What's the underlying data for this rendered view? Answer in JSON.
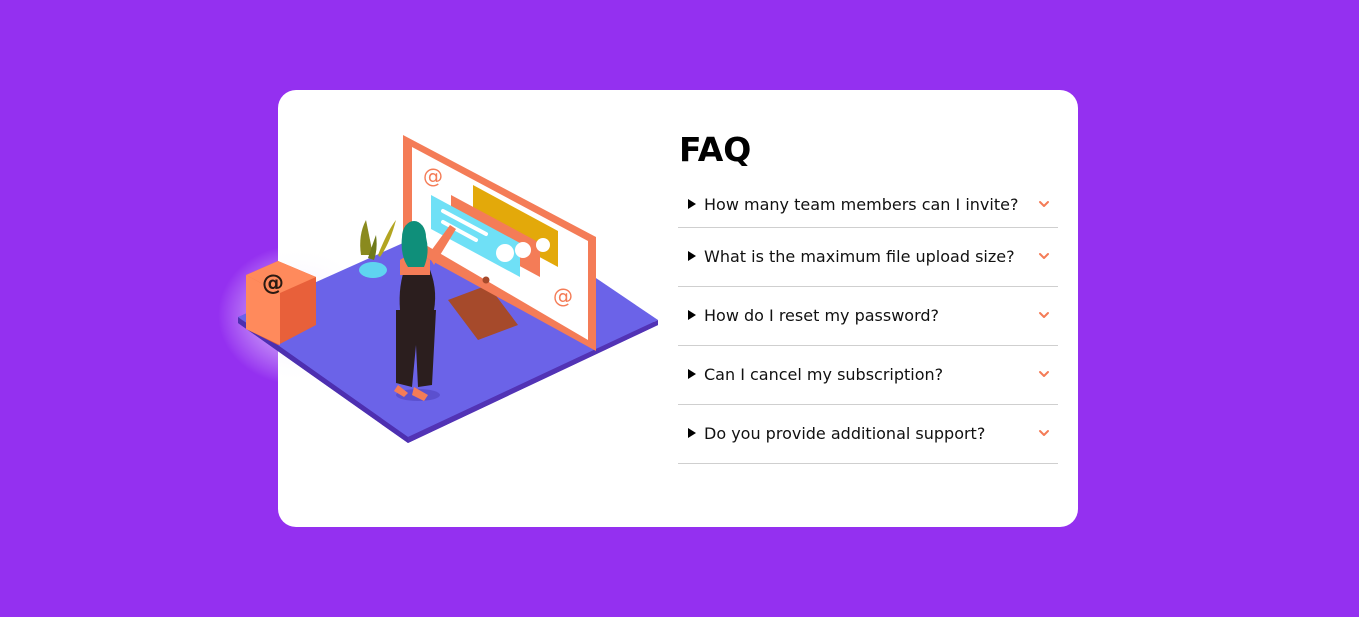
{
  "page": {
    "background_color": "#9430f0"
  },
  "card": {
    "background_color": "#ffffff",
    "illustration": {
      "icon": "woman-at-computer-illustration",
      "screen_glyph": "@"
    },
    "faq": {
      "title": "FAQ",
      "accent_color": "#f47c57",
      "items": [
        {
          "question": "How many team members can I invite?"
        },
        {
          "question": "What is the maximum file upload size?"
        },
        {
          "question": "How do I reset my password?"
        },
        {
          "question": "Can I cancel my subscription?"
        },
        {
          "question": "Do you provide additional support?"
        }
      ]
    }
  }
}
